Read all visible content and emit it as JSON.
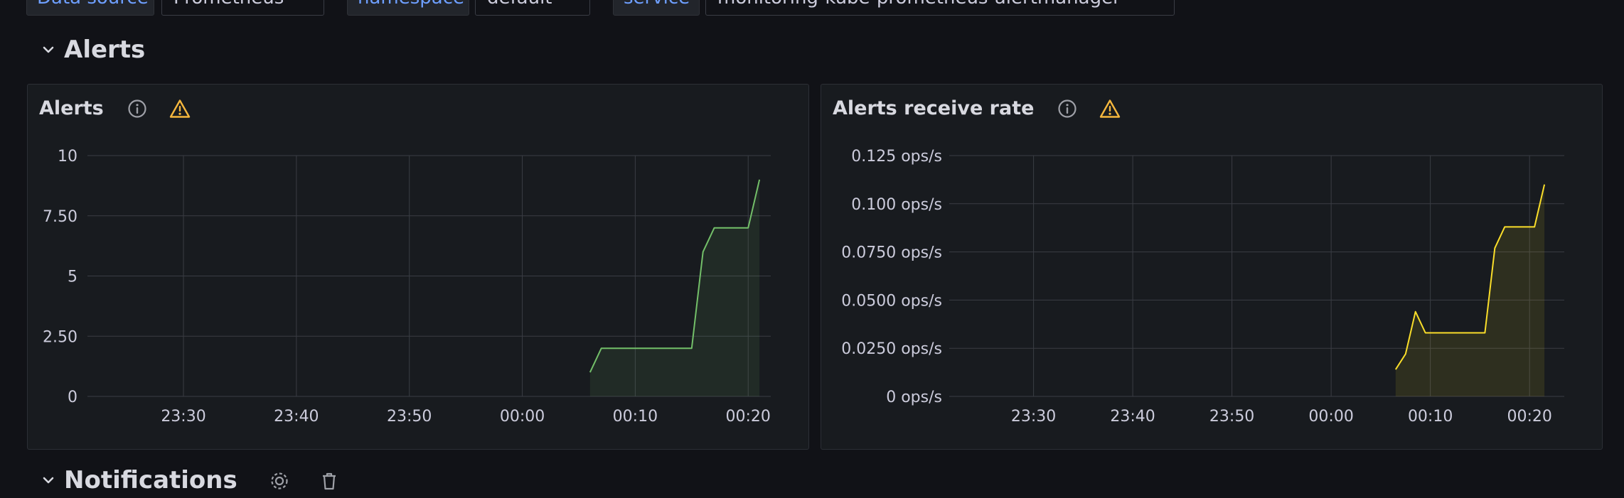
{
  "variables": [
    {
      "label": "Data source",
      "value": "Prometheus"
    },
    {
      "label": "namespace",
      "value": "default"
    },
    {
      "label": "service",
      "value": "monitoring-kube-prometheus-alertmanager"
    }
  ],
  "rows": {
    "alerts": {
      "title": "Alerts"
    },
    "notifications": {
      "title": "Notifications"
    }
  },
  "colors": {
    "series_green": "#73bf69",
    "series_yellow": "#fade2a",
    "warning": "#f5b73d",
    "grid": "#3a3d44",
    "tick_text": "#ccccdc"
  },
  "icons": [
    "chevron-down-icon",
    "info-icon",
    "warning-icon",
    "gear-icon",
    "trash-icon"
  ],
  "panels": [
    {
      "title": "Alerts",
      "chart_data": {
        "type": "area",
        "title": "Alerts",
        "x_tick_labels": [
          "23:30",
          "23:40",
          "23:50",
          "00:00",
          "00:10",
          "00:20"
        ],
        "x_ticks_min": [
          30,
          40,
          50,
          60,
          70,
          80
        ],
        "xlim": [
          21.5,
          82
        ],
        "y_tick_labels": [
          "0",
          "2.50",
          "5",
          "7.50",
          "10"
        ],
        "ylim": [
          0,
          10
        ],
        "series": [
          {
            "color": "#73bf69",
            "x": [
              66,
              67,
              68,
              69,
              70,
              71,
              72,
              73,
              74,
              75,
              76,
              77,
              78,
              79,
              80,
              81
            ],
            "y": [
              1,
              2,
              2,
              2,
              2,
              2,
              2,
              2,
              2,
              2,
              6,
              7,
              7,
              7,
              7,
              9
            ]
          }
        ]
      }
    },
    {
      "title": "Alerts receive rate",
      "chart_data": {
        "type": "area",
        "title": "Alerts receive rate",
        "x_tick_labels": [
          "23:30",
          "23:40",
          "23:50",
          "00:00",
          "00:10",
          "00:20"
        ],
        "x_ticks_min": [
          30,
          40,
          50,
          60,
          70,
          80
        ],
        "xlim": [
          21.5,
          83.5
        ],
        "y_tick_labels": [
          "0 ops/s",
          "0.0250 ops/s",
          "0.0500 ops/s",
          "0.0750 ops/s",
          "0.100 ops/s",
          "0.125 ops/s"
        ],
        "ylim": [
          0,
          0.125
        ],
        "series": [
          {
            "color": "#fade2a",
            "x": [
              66.5,
              67.5,
              68.5,
              69.5,
              70.5,
              71.5,
              72.5,
              73.5,
              74.5,
              75.5,
              76.5,
              77.5,
              78.5,
              79.5,
              80.5,
              81.5
            ],
            "y": [
              0.014,
              0.022,
              0.044,
              0.033,
              0.033,
              0.033,
              0.033,
              0.033,
              0.033,
              0.033,
              0.077,
              0.088,
              0.088,
              0.088,
              0.088,
              0.11
            ]
          }
        ]
      }
    }
  ]
}
